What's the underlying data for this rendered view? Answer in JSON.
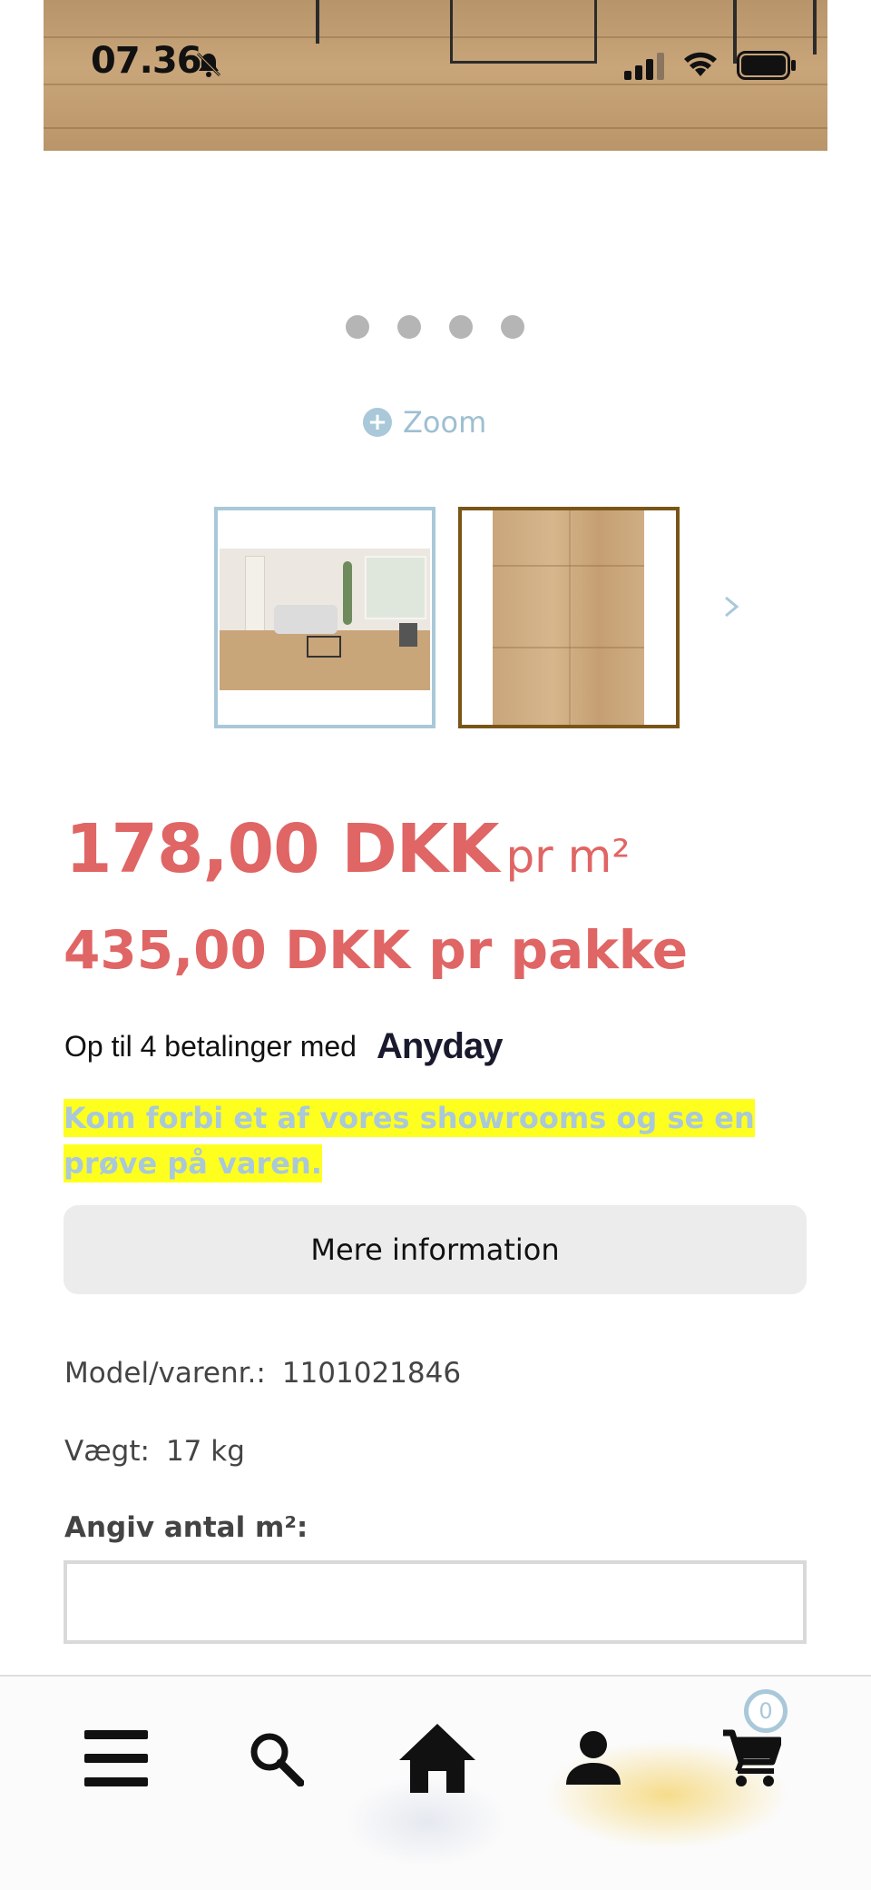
{
  "status_bar": {
    "time": "07.36",
    "icons": [
      "bell-muted-icon",
      "signal-icon",
      "wifi-icon",
      "battery-icon"
    ]
  },
  "gallery": {
    "dots_count": 4,
    "zoom_label": "Zoom",
    "thumbnails": [
      "living-room-floor",
      "oak-plank-closeup"
    ],
    "selected_thumbnail": 1
  },
  "product": {
    "price_per_m2": "178,00 DKK",
    "price_per_m2_unit": "pr m²",
    "price_per_pack": "435,00 DKK pr pakke",
    "financing_text": "Op til 4 betalinger med",
    "financing_brand": "Anyday",
    "showroom_note": "Kom forbi et af vores showrooms og se en prøve på varen.",
    "more_info_label": "Mere information",
    "model_label": "Model/varenr.:",
    "model_value": "1101021846",
    "weight_label": "Vægt:",
    "weight_value": "17 kg",
    "quantity_label": "Angiv antal m²:",
    "quantity_value": ""
  },
  "bottom_nav": {
    "items": [
      "menu-icon",
      "search-icon",
      "home-icon",
      "account-icon",
      "cart-icon"
    ],
    "cart_count": "0"
  },
  "colors": {
    "price": "#e06565",
    "accent_blue": "#a9c8d9",
    "highlight": "#ffff1f",
    "selected_border": "#7a5518"
  }
}
